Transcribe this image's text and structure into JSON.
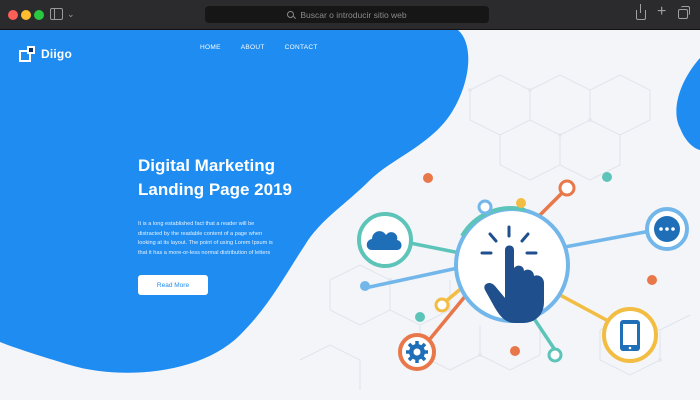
{
  "browser": {
    "address_placeholder": "Buscar o introducir sitio web",
    "icons": [
      "sidebar-icon",
      "chevron-down-icon",
      "search-icon",
      "share-icon",
      "plus-icon",
      "tabs-icon"
    ]
  },
  "site": {
    "logo_text": "Diigo",
    "nav": [
      "HOME",
      "ABOUT",
      "CONTACT"
    ]
  },
  "hero": {
    "title_line1": "Digital Marketing",
    "title_line2": "Landing Page 2019",
    "paragraph_lines": [
      "It is a long established fact that a reader will be",
      "distracted by the readable content of a page when",
      "looking at its layout. The point of using Lorem Ipsum is",
      "that it has a more-or-less normal distribution of letters"
    ],
    "button_label": "Read More"
  },
  "illustration": {
    "icons": [
      "cloud-icon",
      "chat-icon",
      "hand-click-icon",
      "gear-icon",
      "smartphone-icon"
    ]
  },
  "colors": {
    "brand_blue": "#1e8cf0",
    "orange": "#e8774a",
    "teal": "#5cc4b8",
    "yellow": "#f2bd42",
    "light_blue": "#73b7ea",
    "navy": "#1f4f8c"
  }
}
